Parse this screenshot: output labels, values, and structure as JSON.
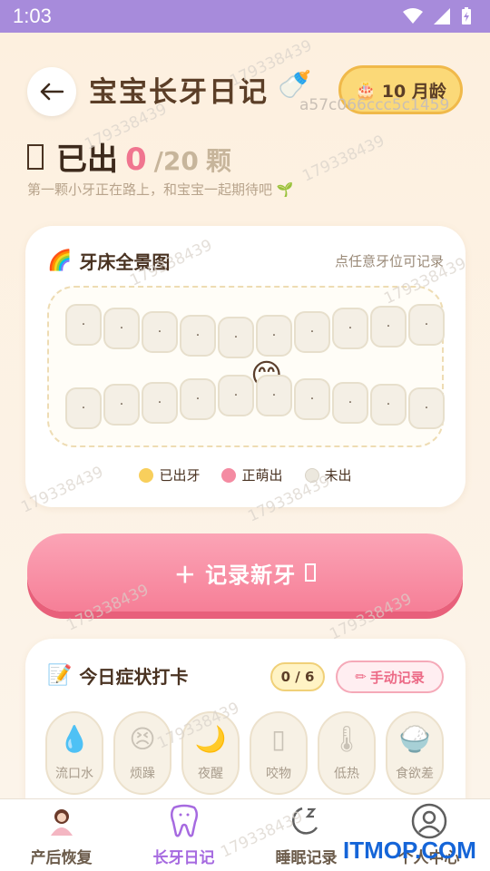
{
  "status": {
    "time": "1:03"
  },
  "header": {
    "title": "宝宝长牙日记",
    "bottle_icon": "🍼",
    "age_icon": "🎂",
    "age_label": "10 月龄",
    "device_id": "a57c066ccc5c1459"
  },
  "counter": {
    "label": "已出",
    "count": "0",
    "total": "/20",
    "unit": "颗",
    "hint": "第一颗小牙正在路上，和宝宝一起期待吧 🌱"
  },
  "gum_card": {
    "icon": "🌈",
    "title": "牙床全景图",
    "tip": "点任意牙位可记录",
    "tooth_mark": "·",
    "face_icon": "😊",
    "legend": [
      {
        "label": "已出牙",
        "color": "#f8cf5c"
      },
      {
        "label": "正萌出",
        "color": "#f48ba2"
      },
      {
        "label": "未出",
        "color": "#ece8de"
      }
    ]
  },
  "record_button": {
    "label": "＋ 记录新牙"
  },
  "symptoms": {
    "icon": "📝",
    "title": "今日症状打卡",
    "count": "0 / 6",
    "manual_label": "手动记录",
    "manual_icon": "✏",
    "items": [
      {
        "label": "流口水",
        "icon": "💧"
      },
      {
        "label": "烦躁",
        "icon": "😣"
      },
      {
        "label": "夜醒",
        "icon": "🌙"
      },
      {
        "label": "咬物",
        "icon": "▯"
      },
      {
        "label": "低热",
        "icon": "🌡"
      },
      {
        "label": "食欲差",
        "icon": "🍚"
      }
    ]
  },
  "tabs": [
    {
      "label": "产后恢复"
    },
    {
      "label": "长牙日记"
    },
    {
      "label": "睡眠记录"
    },
    {
      "label": "个人中心"
    }
  ],
  "watermark": "179338439",
  "brand": "ITMOP.COM"
}
